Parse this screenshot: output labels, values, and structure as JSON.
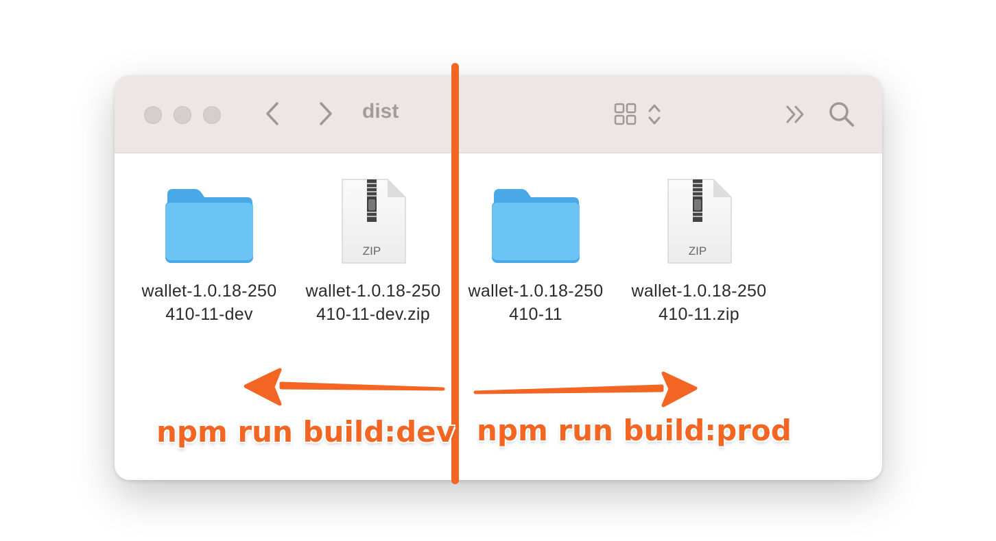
{
  "window": {
    "title": "dist"
  },
  "toolbar": {
    "back_icon": "chevron-left-icon",
    "forward_icon": "chevron-right-icon",
    "view_icon": "grid-view-icon",
    "more_icon": "double-chevron-right-icon",
    "search_icon": "search-icon"
  },
  "files": [
    {
      "name": "wallet-1.0.18-250\n410-11-dev",
      "kind": "folder"
    },
    {
      "name": "wallet-1.0.18-250\n410-11-dev.zip",
      "kind": "zip",
      "badge": "ZIP"
    },
    {
      "name": "wallet-1.0.18-250\n410-11",
      "kind": "folder"
    },
    {
      "name": "wallet-1.0.18-250\n410-11.zip",
      "kind": "zip",
      "badge": "ZIP"
    }
  ],
  "annotations": {
    "left_label": "npm run build:dev",
    "right_label": "npm run build:prod",
    "accent_color": "#f26522"
  },
  "colors": {
    "toolbar_bg": "#ece6e5",
    "folder_blue": "#6cc4f5",
    "folder_tab": "#4aa8e6"
  }
}
